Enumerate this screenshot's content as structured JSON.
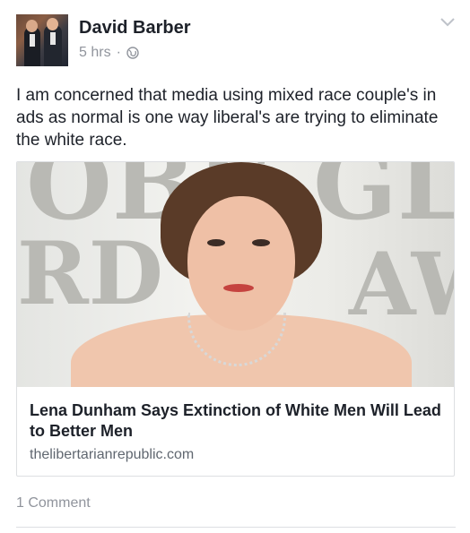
{
  "post": {
    "author_name": "David Barber",
    "timestamp": "5 hrs",
    "separator": "·",
    "privacy_icon": "globe-icon",
    "menu_icon": "chevron-down-icon",
    "text": "I am concerned that media using mixed race couple's in ads as normal is one way liberal's are trying to eliminate the white race."
  },
  "link_card": {
    "title": "Lena Dunham Says Extinction of White Men Will Lead to Better Men",
    "domain": "thelibertarianrepublic.com"
  },
  "footer": {
    "comments_label": "1 Comment"
  },
  "colors": {
    "primary_text": "#1d2129",
    "secondary_text": "#90949c",
    "border": "#dddfe2"
  }
}
